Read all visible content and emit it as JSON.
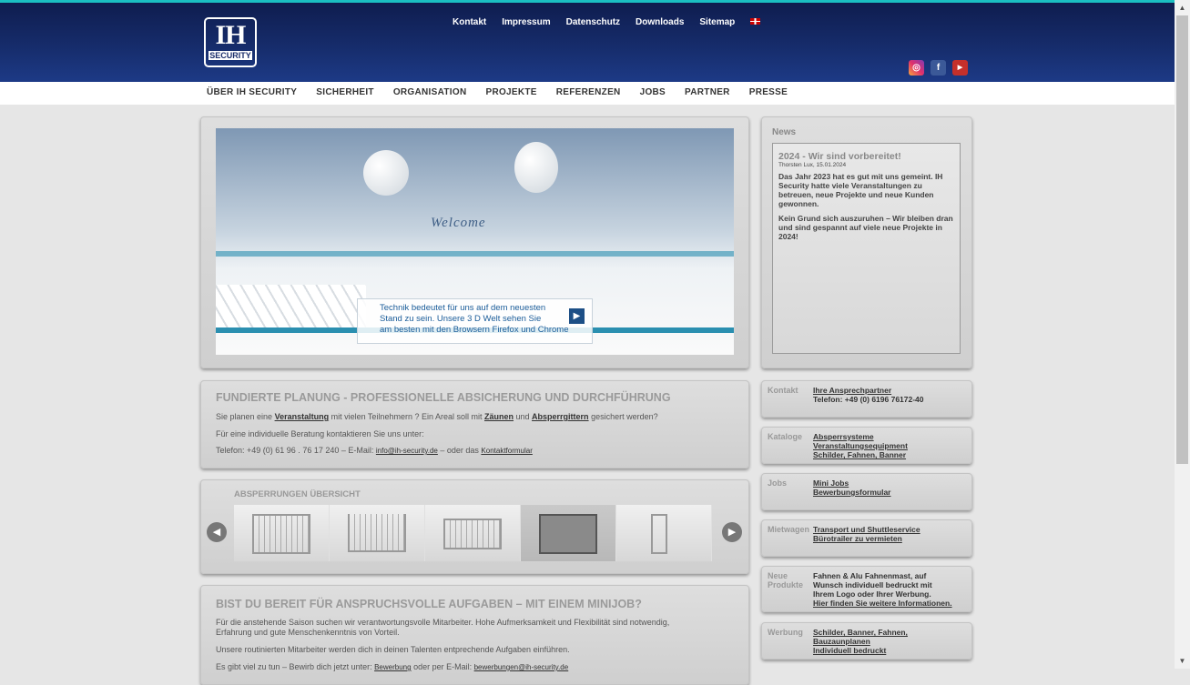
{
  "logo": {
    "big": "IH",
    "small": "SECURITY"
  },
  "topnav": [
    "Kontakt",
    "Impressum",
    "Datenschutz",
    "Downloads",
    "Sitemap"
  ],
  "mainnav": [
    "ÜBER IH SECURITY",
    "SICHERHEIT",
    "ORGANISATION",
    "PROJEKTE",
    "REFERENZEN",
    "JOBS",
    "PARTNER",
    "PRESSE"
  ],
  "hero": {
    "welcome": "Welcome",
    "text": [
      "Technik bedeutet für uns auf dem neuesten",
      "Stand zu sein. Unsere 3 D Welt sehen Sie",
      "am besten mit den Browsern Firefox und Chrome"
    ],
    "button": "▶"
  },
  "news": {
    "title": "News",
    "headline": "2024 - Wir sind vorbereitet!",
    "meta": "Thorsten Lux, 15.01.2024",
    "p1": "Das Jahr 2023 hat es gut mit uns gemeint. IH Security hatte viele Veranstaltungen zu betreuen, neue Projekte und neue Kunden gewonnen.",
    "p2": "Kein Grund sich auszuruhen – Wir bleiben dran und sind gespannt auf viele neue Projekte in 2024!"
  },
  "planung": {
    "title": "FUNDIERTE PLANUNG - PROFESSIONELLE ABSICHERUNG UND DURCHFÜHRUNG",
    "l1a": "Sie planen eine ",
    "l1link1": "Veranstaltung",
    "l1b": " mit vielen Teilnehmern ? Ein Areal soll mit ",
    "l1link2": "Zäunen",
    "l1c": " und ",
    "l1link3": "Absperrgittern",
    "l1d": " gesichert werden?",
    "l2": "Für eine individuelle Beratung kontaktieren Sie uns unter:",
    "l3a": "Telefon: +49 (0) 61 96 . 76 17 240  –  E-Mail: ",
    "email": "info@ih-security.de",
    "l3b": "  –  oder das ",
    "kontaktform": "Kontaktformular"
  },
  "barrier": {
    "title": "ABSPERRUNGEN ÜBERSICHT",
    "prev": "◀",
    "next": "▶"
  },
  "minijob": {
    "title": "BIST DU BEREIT FÜR ANSPRUCHSVOLLE AUFGABEN – MIT EINEM MINIJOB?",
    "l1": "Für die anstehende Saison suchen wir verantwortungsvolle Mitarbeiter. Hohe Aufmerksamkeit und Flexibilität sind notwendig,",
    "l2": "Erfahrung und gute Menschenkenntnis von Vorteil.",
    "l3": "Unsere routinierten Mitarbeiter werden dich in deinen Talenten entprechende Aufgaben einführen.",
    "l4a": "Es gibt viel zu tun – Bewirb dich jetzt unter: ",
    "l4link": "Bewerbung",
    "l4b": " oder per E-Mail: ",
    "l4email": "bewerbungen@ih-security.de"
  },
  "side": {
    "kontakt": {
      "label": "Kontakt",
      "link": "Ihre Ansprechpartner",
      "text": "Telefon: +49 (0) 6196 76172-40"
    },
    "kataloge": {
      "label": "Kataloge",
      "links": [
        "Absperrsysteme",
        "Veranstaltungsequipment",
        "Schilder, Fahnen, Banner"
      ]
    },
    "jobs": {
      "label": "Jobs",
      "links": [
        "Mini Jobs",
        "Bewerbungsformular"
      ]
    },
    "mietwagen": {
      "label": "Mietwagen",
      "links": [
        "Transport und Shuttleservice",
        "Bürotrailer zu vermieten"
      ]
    },
    "produkte": {
      "label1": "Neue",
      "label2": "Produkte",
      "text": [
        "Fahnen & Alu Fahnenmast, auf",
        "Wunsch individuell bedruckt mit",
        "Ihrem Logo oder Ihrer Werbung."
      ],
      "link": "Hier finden Sie weitere Informationen."
    },
    "werbung": {
      "label": "Werbung",
      "links": [
        "Schilder, Banner, Fahnen,",
        "Bauzaunplanen",
        "Individuell bedruckt"
      ]
    }
  },
  "colors": {
    "header": "#162c6b",
    "accent": "#1bbfc2",
    "link": "#333333"
  }
}
